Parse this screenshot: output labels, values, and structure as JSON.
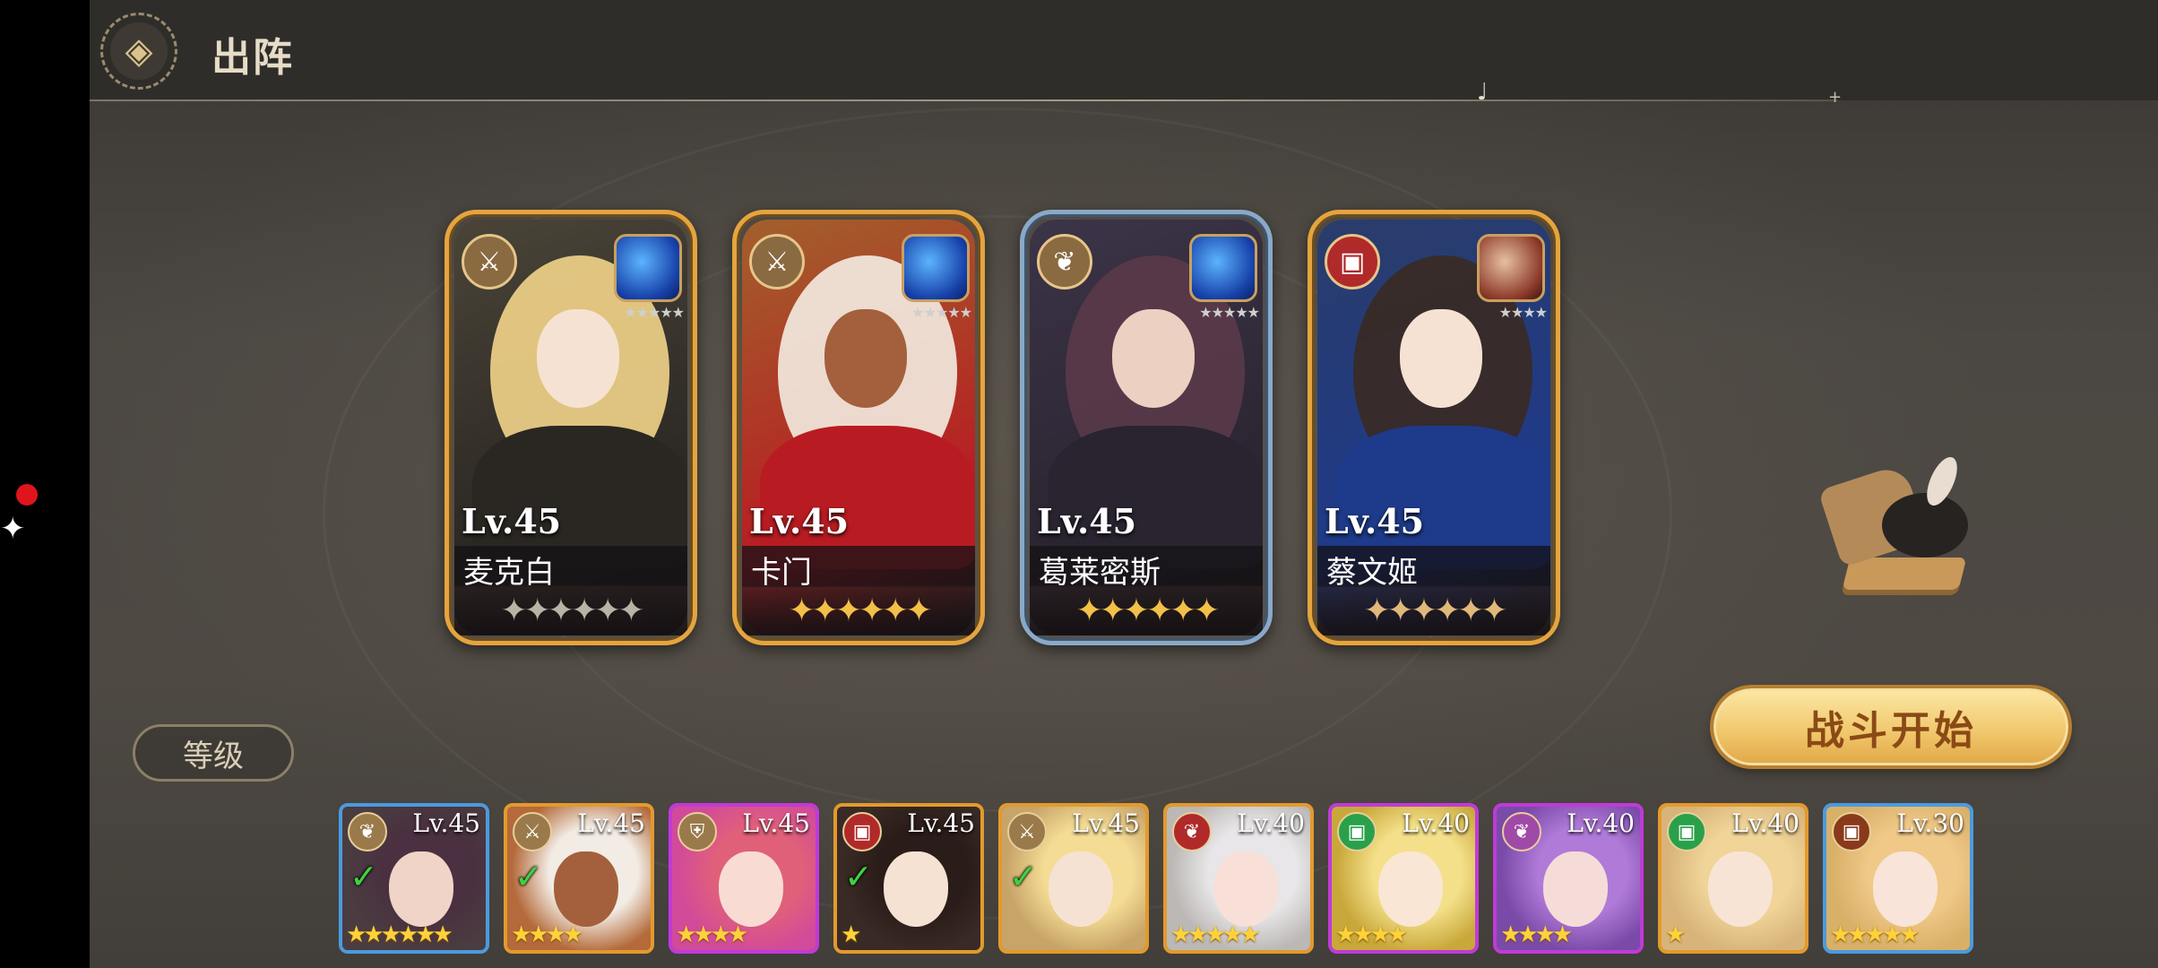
{
  "header": {
    "title": "出阵",
    "back_icon": "back-diamond-icon"
  },
  "formation": [
    {
      "name": "麦克白",
      "level": "Lv.45",
      "class_icon": "⚔",
      "class_color": "#8a6a40",
      "frame": "gold",
      "element": "blue",
      "stars": "✦✦✦✦✦✦",
      "star_color": "#b9b3a6",
      "elem_stars": "★★★★★",
      "palette": {
        "bg": "#4a4438",
        "hair": "#f2d48a",
        "outfit": "#2a2622",
        "skin": "#f6e2d2"
      }
    },
    {
      "name": "卡门",
      "level": "Lv.45",
      "class_icon": "⚔",
      "class_color": "#8a6a40",
      "frame": "gold",
      "element": "blue",
      "stars": "✦✦✦✦✦✦",
      "star_color": "#f2c048",
      "elem_stars": "★★★★★",
      "palette": {
        "bg": "#a2602c",
        "hair": "#f4ece2",
        "outfit": "#b81c22",
        "skin": "#a4603c"
      }
    },
    {
      "name": "葛莱密斯",
      "level": "Lv.45",
      "class_icon": "❦",
      "class_color": "#8a6a40",
      "frame": "blue",
      "element": "blue",
      "stars": "✦✦✦✦✦✦",
      "star_color": "#f2c048",
      "elem_stars": "★★★★★",
      "palette": {
        "bg": "#3c3448",
        "hair": "#5a3a4a",
        "outfit": "#2a2430",
        "skin": "#ecd0c2"
      }
    },
    {
      "name": "蔡文姬",
      "level": "Lv.45",
      "class_icon": "▣",
      "class_color": "#b02a2a",
      "frame": "gold",
      "element": "red",
      "stars": "✦✦✦✦✦✦",
      "star_color": "#e0b87a",
      "elem_stars": "★★★★",
      "palette": {
        "bg": "#2a3c6a",
        "hair": "#3a2a22",
        "outfit": "#1e3a8a",
        "skin": "#f6e2d2"
      }
    }
  ],
  "battle_button": "战斗开始",
  "sort_button": "等级",
  "roster": [
    {
      "level": "Lv.45",
      "class_icon": "❦",
      "class_bg": "#9a7a4a",
      "checked": true,
      "stars": "★★★★★★",
      "frame": "blue",
      "palette": {
        "bg": "#4a3c40",
        "hair": "#4a3040",
        "skin": "#f0d4c8"
      }
    },
    {
      "level": "Lv.45",
      "class_icon": "⚔",
      "class_bg": "#9a7a4a",
      "checked": true,
      "stars": "★★★★",
      "frame": "gold",
      "palette": {
        "bg": "#b46a3a",
        "hair": "#f2ece4",
        "skin": "#a4603c"
      }
    },
    {
      "level": "Lv.45",
      "class_icon": "⛨",
      "class_bg": "#9a7a4a",
      "checked": false,
      "stars": "★★★★",
      "frame": "purple",
      "palette": {
        "bg": "#d24a9a",
        "hair": "#e0607a",
        "skin": "#f8dcd4"
      }
    },
    {
      "level": "Lv.45",
      "class_icon": "▣",
      "class_bg": "#b02a2a",
      "checked": true,
      "stars": "★",
      "frame": "gold",
      "palette": {
        "bg": "#3a2a26",
        "hair": "#2a1c18",
        "skin": "#f6e2d2"
      }
    },
    {
      "level": "Lv.45",
      "class_icon": "⚔",
      "class_bg": "#9a7a4a",
      "checked": true,
      "stars": "",
      "frame": "gold",
      "palette": {
        "bg": "#c8a468",
        "hair": "#f4dc94",
        "skin": "#f6e2d2"
      }
    },
    {
      "level": "Lv.40",
      "class_icon": "❦",
      "class_bg": "#b02a2a",
      "checked": false,
      "stars": "★★★★★",
      "frame": "gold",
      "palette": {
        "bg": "#bcb8b6",
        "hair": "#e8e6e8",
        "skin": "#f8e0d8"
      }
    },
    {
      "level": "Lv.40",
      "class_icon": "▣",
      "class_bg": "#2aa04a",
      "checked": false,
      "stars": "★★★★",
      "frame": "purple",
      "palette": {
        "bg": "#c8a83a",
        "hair": "#f4e08a",
        "skin": "#fae6d4"
      }
    },
    {
      "level": "Lv.40",
      "class_icon": "❦",
      "class_bg": "#a04aa8",
      "checked": false,
      "stars": "★★★★",
      "frame": "purple",
      "palette": {
        "bg": "#7a4aa8",
        "hair": "#b07ad8",
        "skin": "#f6dcd8"
      }
    },
    {
      "level": "Lv.40",
      "class_icon": "▣",
      "class_bg": "#2aa04a",
      "checked": false,
      "stars": "★",
      "frame": "gold",
      "palette": {
        "bg": "#d8b47a",
        "hair": "#f0d498",
        "skin": "#f8e4d4"
      }
    },
    {
      "level": "Lv.30",
      "class_icon": "▣",
      "class_bg": "#8a3a1a",
      "checked": false,
      "stars": "★★★★★",
      "frame": "blue",
      "palette": {
        "bg": "#d8b068",
        "hair": "#f0c888",
        "skin": "#f8e4d8"
      }
    }
  ]
}
